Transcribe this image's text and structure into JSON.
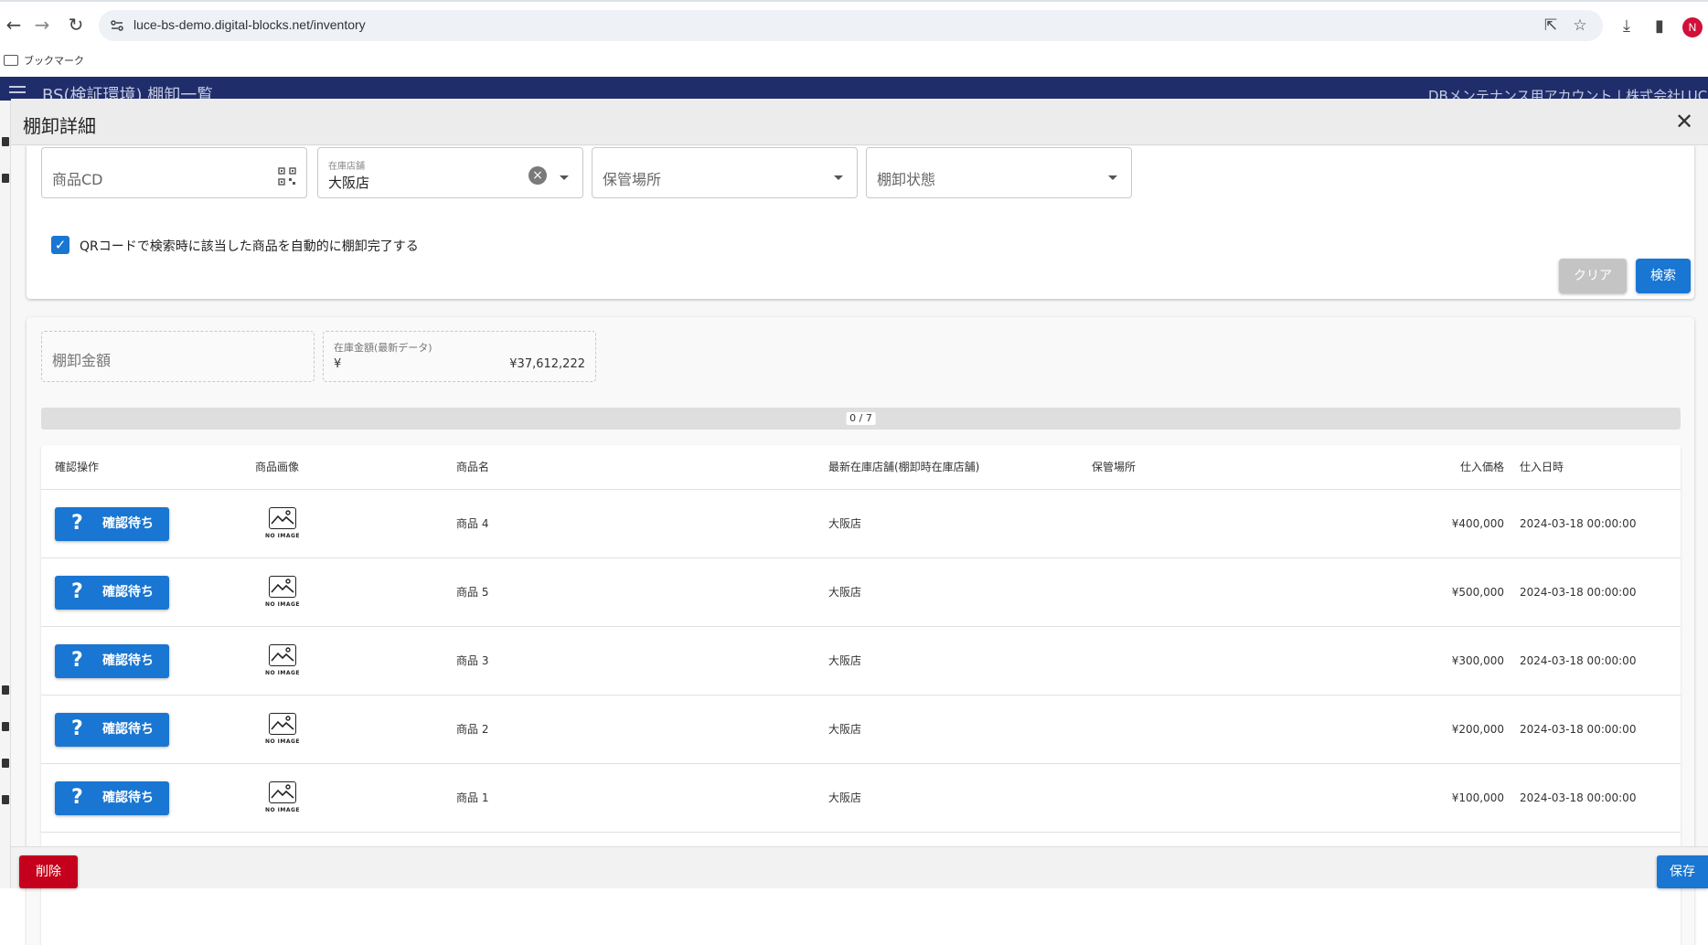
{
  "browser": {
    "url": "luce-bs-demo.digital-blocks.net/inventory",
    "bookmark_folder": "ブックマーク",
    "profile_initial": "N"
  },
  "app": {
    "header_title": "BS(検証環境) 棚卸一覧",
    "user_label": "DBメンテナンス用アカウント | 株式会社LUCE"
  },
  "dialog": {
    "title": "棚卸詳細",
    "close_icon": "close-icon"
  },
  "search": {
    "product_cd_label": "商品CD",
    "store_label": "在庫店舗",
    "store_value": "大阪店",
    "location_label": "保管場所",
    "status_label": "棚卸状態",
    "auto_complete_checked": true,
    "auto_complete_label": "QRコードで検索時に該当した商品を自動的に棚卸完了する",
    "clear_button": "クリア",
    "search_button": "検索"
  },
  "summary": {
    "inventory_amount_label": "棚卸金額",
    "stock_amount_label": "在庫金額(最新データ)",
    "stock_amount_currency": "¥",
    "stock_amount_value": "¥37,612,222"
  },
  "progress": {
    "text": "0 / 7",
    "fraction": 0
  },
  "table": {
    "columns": {
      "action": "確認操作",
      "image": "商品画像",
      "name": "商品名",
      "store": "最新在庫店舗(棚卸時在庫店舗)",
      "location": "保管場所",
      "price": "仕入価格",
      "date": "仕入日時"
    },
    "no_image_text": "NO IMAGE",
    "rows": [
      {
        "action": "確認待ち",
        "name": "商品 4",
        "store": "大阪店",
        "location": "",
        "price": "¥400,000",
        "date": "2024-03-18 00:00:00"
      },
      {
        "action": "確認待ち",
        "name": "商品 5",
        "store": "大阪店",
        "location": "",
        "price": "¥500,000",
        "date": "2024-03-18 00:00:00"
      },
      {
        "action": "確認待ち",
        "name": "商品 3",
        "store": "大阪店",
        "location": "",
        "price": "¥300,000",
        "date": "2024-03-18 00:00:00"
      },
      {
        "action": "確認待ち",
        "name": "商品 2",
        "store": "大阪店",
        "location": "",
        "price": "¥200,000",
        "date": "2024-03-18 00:00:00"
      },
      {
        "action": "確認待ち",
        "name": "商品 1",
        "store": "大阪店",
        "location": "",
        "price": "¥100,000",
        "date": "2024-03-18 00:00:00"
      }
    ]
  },
  "footer": {
    "delete_button": "削除",
    "save_button": "保存"
  },
  "colors": {
    "primary": "#1976d2",
    "danger": "#c5001c",
    "app_header": "#1f2d6b"
  }
}
